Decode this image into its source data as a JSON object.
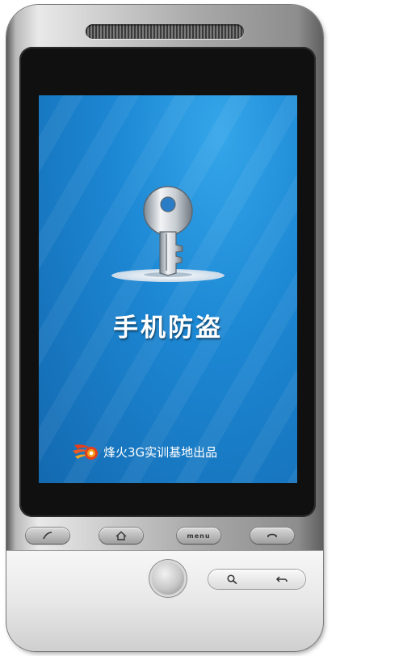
{
  "app": {
    "title": "手机防盗",
    "credit": "烽火3G实训基地出品"
  },
  "device_keys": {
    "call": "call-icon",
    "home": "home-icon",
    "menu": "menu",
    "end_call": "end-call-icon",
    "search": "search-icon",
    "back": "back-icon"
  },
  "colors": {
    "screen_blue": "#1d88d4",
    "title_text": "#ffffff",
    "logo_red": "#e2401e",
    "logo_orange": "#f7a21b"
  }
}
